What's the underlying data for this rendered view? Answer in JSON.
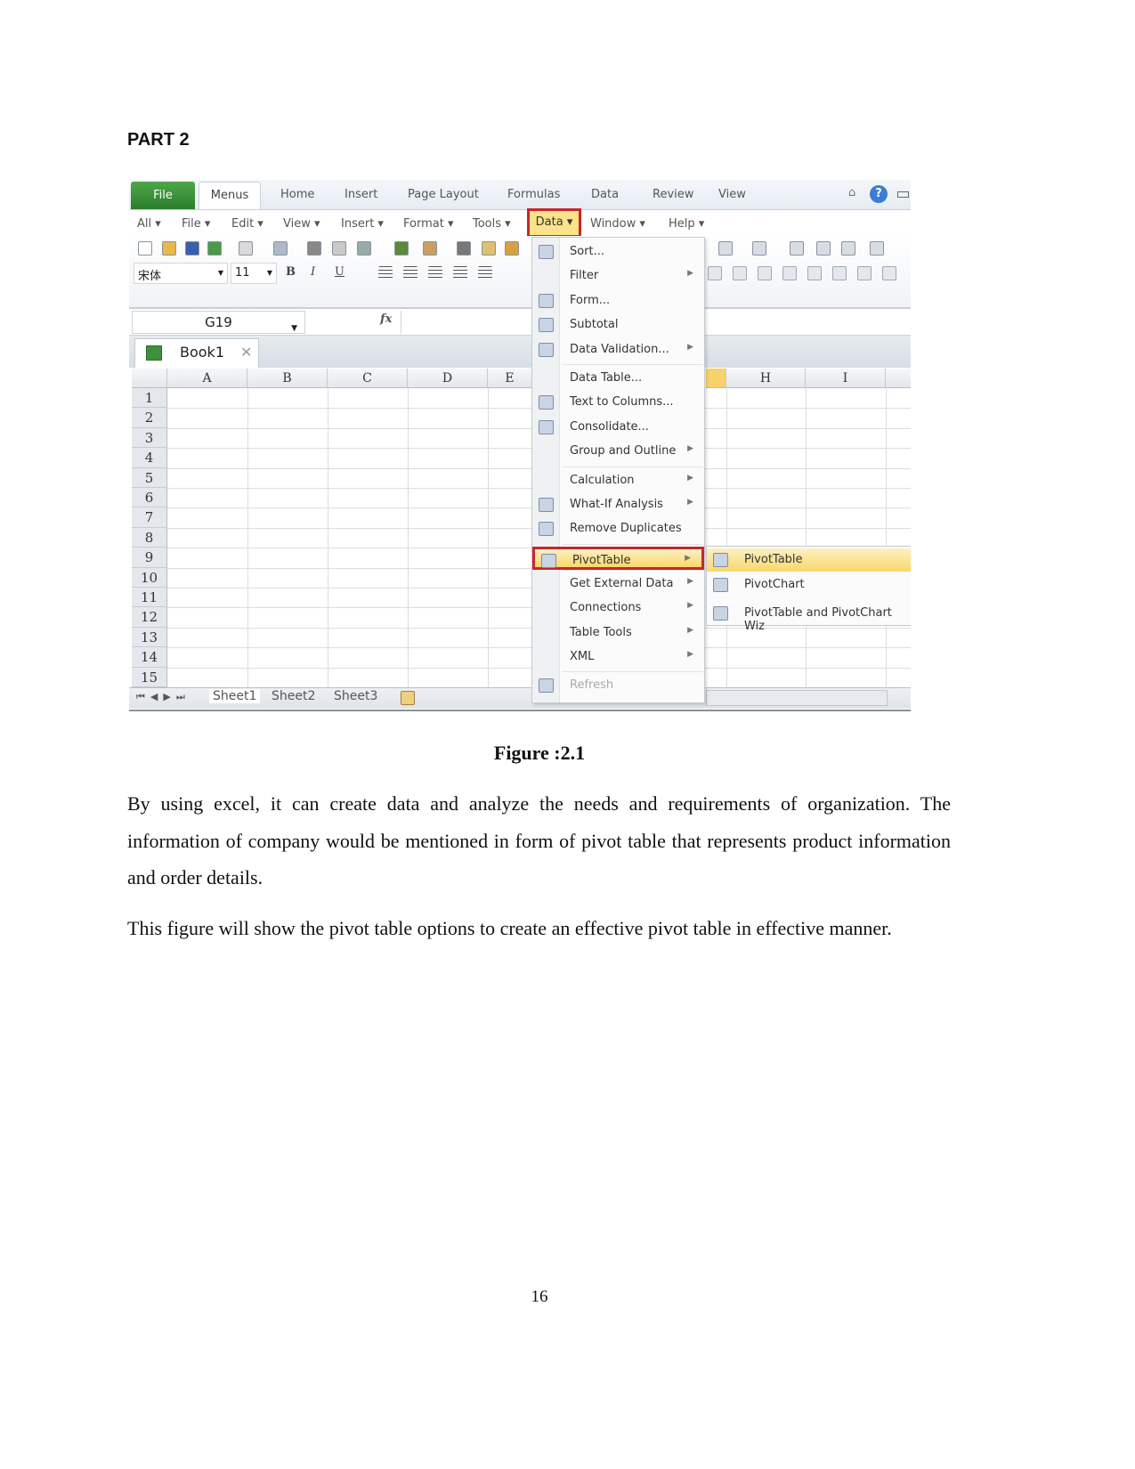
{
  "heading": "PART 2",
  "figure": {
    "ribbon_tabs": [
      "File",
      "Menus",
      "Home",
      "Insert",
      "Page Layout",
      "Formulas",
      "Data",
      "Review",
      "View"
    ],
    "menu_bar": [
      "All ▾",
      "File ▾",
      "Edit ▾",
      "View ▾",
      "Insert ▾",
      "Format ▾",
      "Tools ▾",
      "Data ▾",
      "Window ▾",
      "Help ▾"
    ],
    "font_name": "宋体",
    "font_size": "11",
    "name_box": "G19",
    "fx_label": "fx",
    "workbook_tab": "Book1",
    "columns": [
      "A",
      "B",
      "C",
      "D",
      "E",
      "H",
      "I"
    ],
    "rows": [
      "1",
      "2",
      "3",
      "4",
      "5",
      "6",
      "7",
      "8",
      "9",
      "10",
      "11",
      "12",
      "13",
      "14",
      "15"
    ],
    "sheet_tabs": [
      "Sheet1",
      "Sheet2",
      "Sheet3"
    ],
    "data_menu": [
      {
        "label": "Sort...",
        "icon": "sort-az-icon"
      },
      {
        "label": "Filter",
        "submenu": true
      },
      {
        "label": "Form...",
        "icon": "form-icon"
      },
      {
        "label": "Subtotal",
        "icon": "subtotal-icon"
      },
      {
        "label": "Data Validation...",
        "submenu": true,
        "icon": "data-validation-icon",
        "separator_after": true
      },
      {
        "label": "Data Table..."
      },
      {
        "label": "Text to Columns...",
        "icon": "text-to-columns-icon"
      },
      {
        "label": "Consolidate...",
        "icon": "consolidate-icon"
      },
      {
        "label": "Group and Outline",
        "submenu": true,
        "separator_after": true
      },
      {
        "label": "Calculation",
        "submenu": true
      },
      {
        "label": "What-If Analysis",
        "submenu": true,
        "icon": "what-if-icon"
      },
      {
        "label": "Remove Duplicates",
        "icon": "remove-duplicates-icon",
        "separator_after": true
      },
      {
        "label": "PivotTable",
        "submenu": true,
        "icon": "pivottable-icon",
        "highlighted": true,
        "separator_after": true
      },
      {
        "label": "Get External Data",
        "submenu": true
      },
      {
        "label": "Connections",
        "submenu": true
      },
      {
        "label": "Table Tools",
        "submenu": true
      },
      {
        "label": "XML",
        "submenu": true,
        "separator_after": true
      },
      {
        "label": "Refresh",
        "disabled": true,
        "icon": "refresh-icon"
      }
    ],
    "pivot_submenu": [
      {
        "label": "PivotTable",
        "icon": "pivottable-icon",
        "highlighted": true
      },
      {
        "label": "PivotChart",
        "icon": "pivotchart-icon"
      },
      {
        "label": "PivotTable and PivotChart Wiz",
        "icon": "pivot-wizard-icon"
      }
    ],
    "colors": {
      "file_tab": "#3a923a",
      "highlight_box": "#c8262a",
      "menu_highlight": "#fbd76a",
      "help_icon": "#3a7dd1"
    }
  },
  "caption": "Figure :2.1",
  "paragraphs": [
    "By using excel, it can create data and analyze the needs and requirements of organization. The information of company would be mentioned in form of pivot table that represents product information and order details.",
    "This figure will show the pivot table options to create an effective pivot table in effective manner."
  ],
  "page_number": "16"
}
